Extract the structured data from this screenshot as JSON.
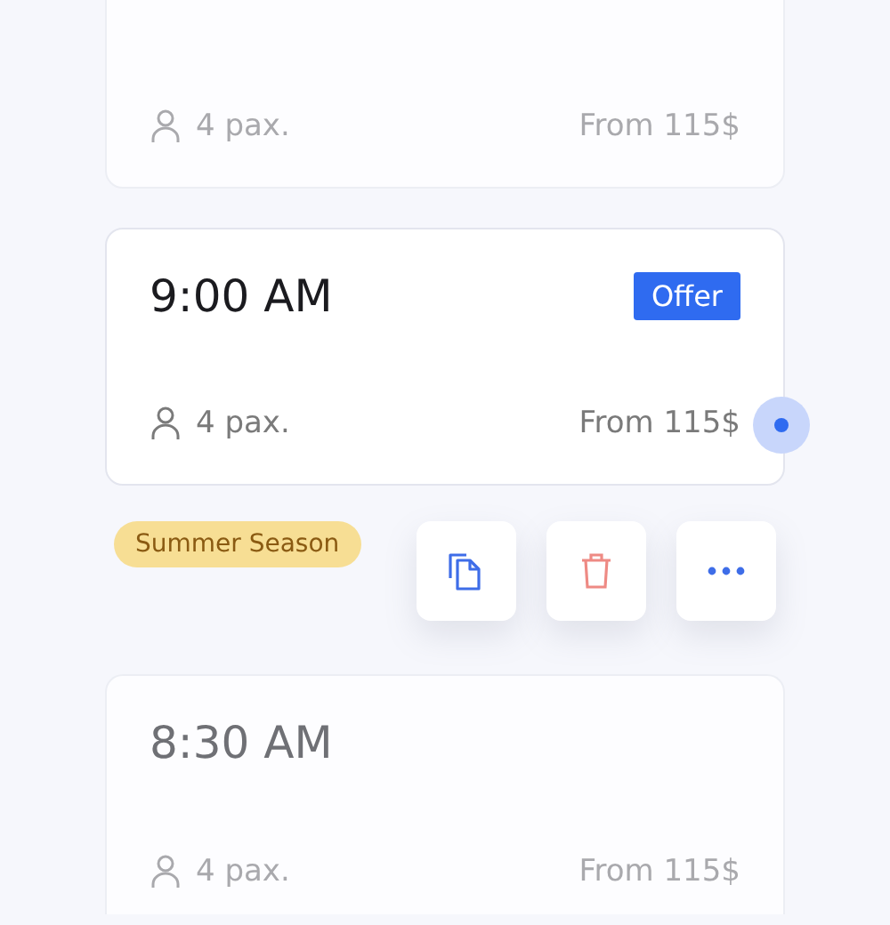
{
  "cards": [
    {
      "pax": "4 pax.",
      "price": "From 115$",
      "dimmed": true,
      "selected": false
    },
    {
      "time": "9:00 AM",
      "pax": "4 pax.",
      "price": "From 115$",
      "dimmed": false,
      "selected": true,
      "badge": "Offer"
    },
    {
      "time": "8:30 AM",
      "pax": "4 pax.",
      "price": "From 115$",
      "dimmed": true,
      "selected": false
    }
  ],
  "tag": "Summer Season",
  "actions": [
    {
      "kind": "copy"
    },
    {
      "kind": "delete"
    },
    {
      "kind": "more"
    }
  ]
}
